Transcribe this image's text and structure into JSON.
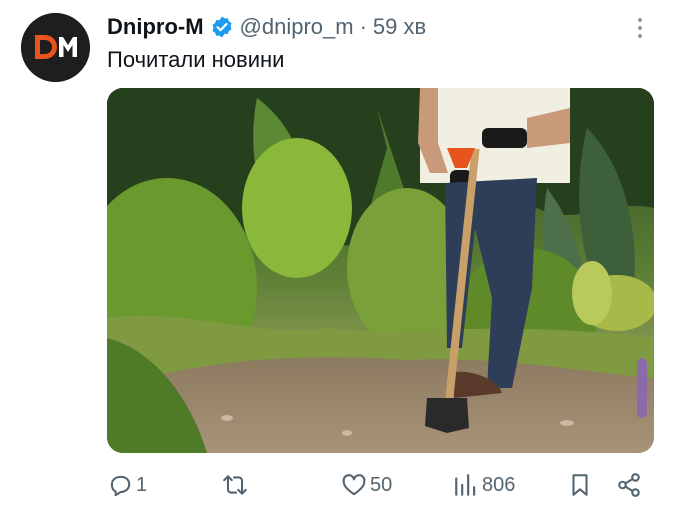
{
  "tweet": {
    "author_name": "Dnipro-M",
    "handle": "@dnipro_m",
    "separator": "·",
    "time": "59 хв",
    "text": "Почитали новини",
    "avatar_logo_text": "DM",
    "verified_color": "#1d9bf0"
  },
  "media": {
    "icon": "photo-gardener-with-shovel"
  },
  "actions": {
    "reply_count": "1",
    "retweet_count": "",
    "like_count": "50",
    "views_count": "806"
  },
  "colors": {
    "text_primary": "#0f1419",
    "text_secondary": "#536471",
    "brand_orange": "#e8541e"
  }
}
